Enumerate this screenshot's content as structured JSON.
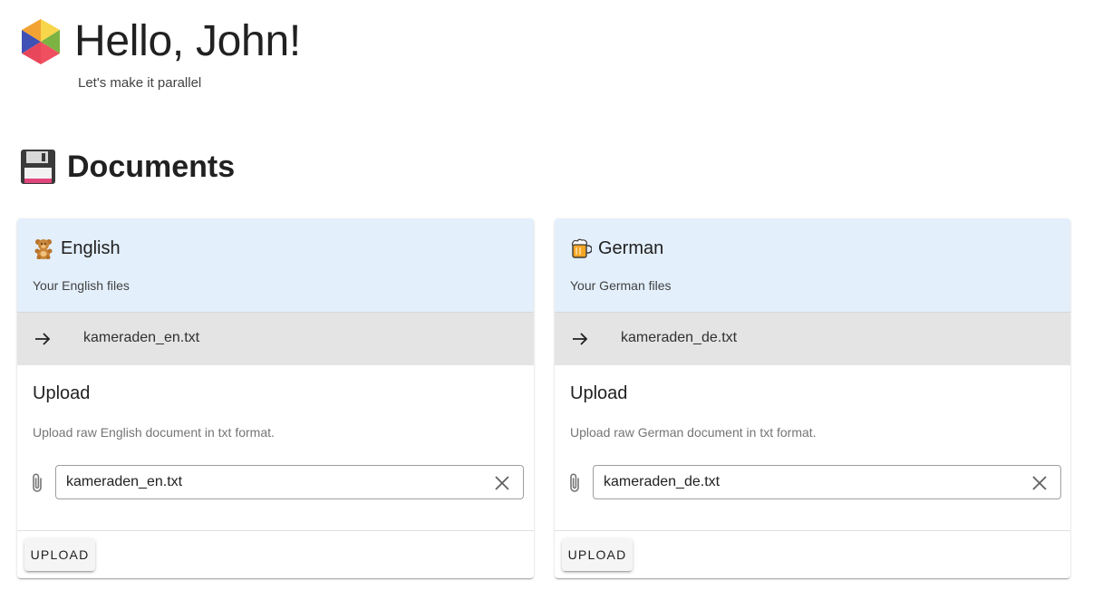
{
  "header": {
    "greeting": "Hello, John!",
    "subtitle": "Let's make it parallel"
  },
  "documents": {
    "title": "Documents",
    "icon": "floppy-disk-icon"
  },
  "cards": [
    {
      "language": "English",
      "icon": "teddy-bear-icon",
      "subtitle": "Your English files",
      "files": [
        "kameraden_en.txt"
      ],
      "upload_title": "Upload",
      "upload_description": "Upload raw English document in txt format.",
      "upload_value": "kameraden_en.txt",
      "button_label": "UPLOAD"
    },
    {
      "language": "German",
      "icon": "beer-mug-icon",
      "subtitle": "Your German files",
      "files": [
        "kameraden_de.txt"
      ],
      "upload_title": "Upload",
      "upload_description": "Upload raw German document in txt format.",
      "upload_value": "kameraden_de.txt",
      "button_label": "UPLOAD"
    }
  ],
  "colors": {
    "card_header_bg": "#e3effb",
    "file_row_bg": "#e4e4e4"
  }
}
